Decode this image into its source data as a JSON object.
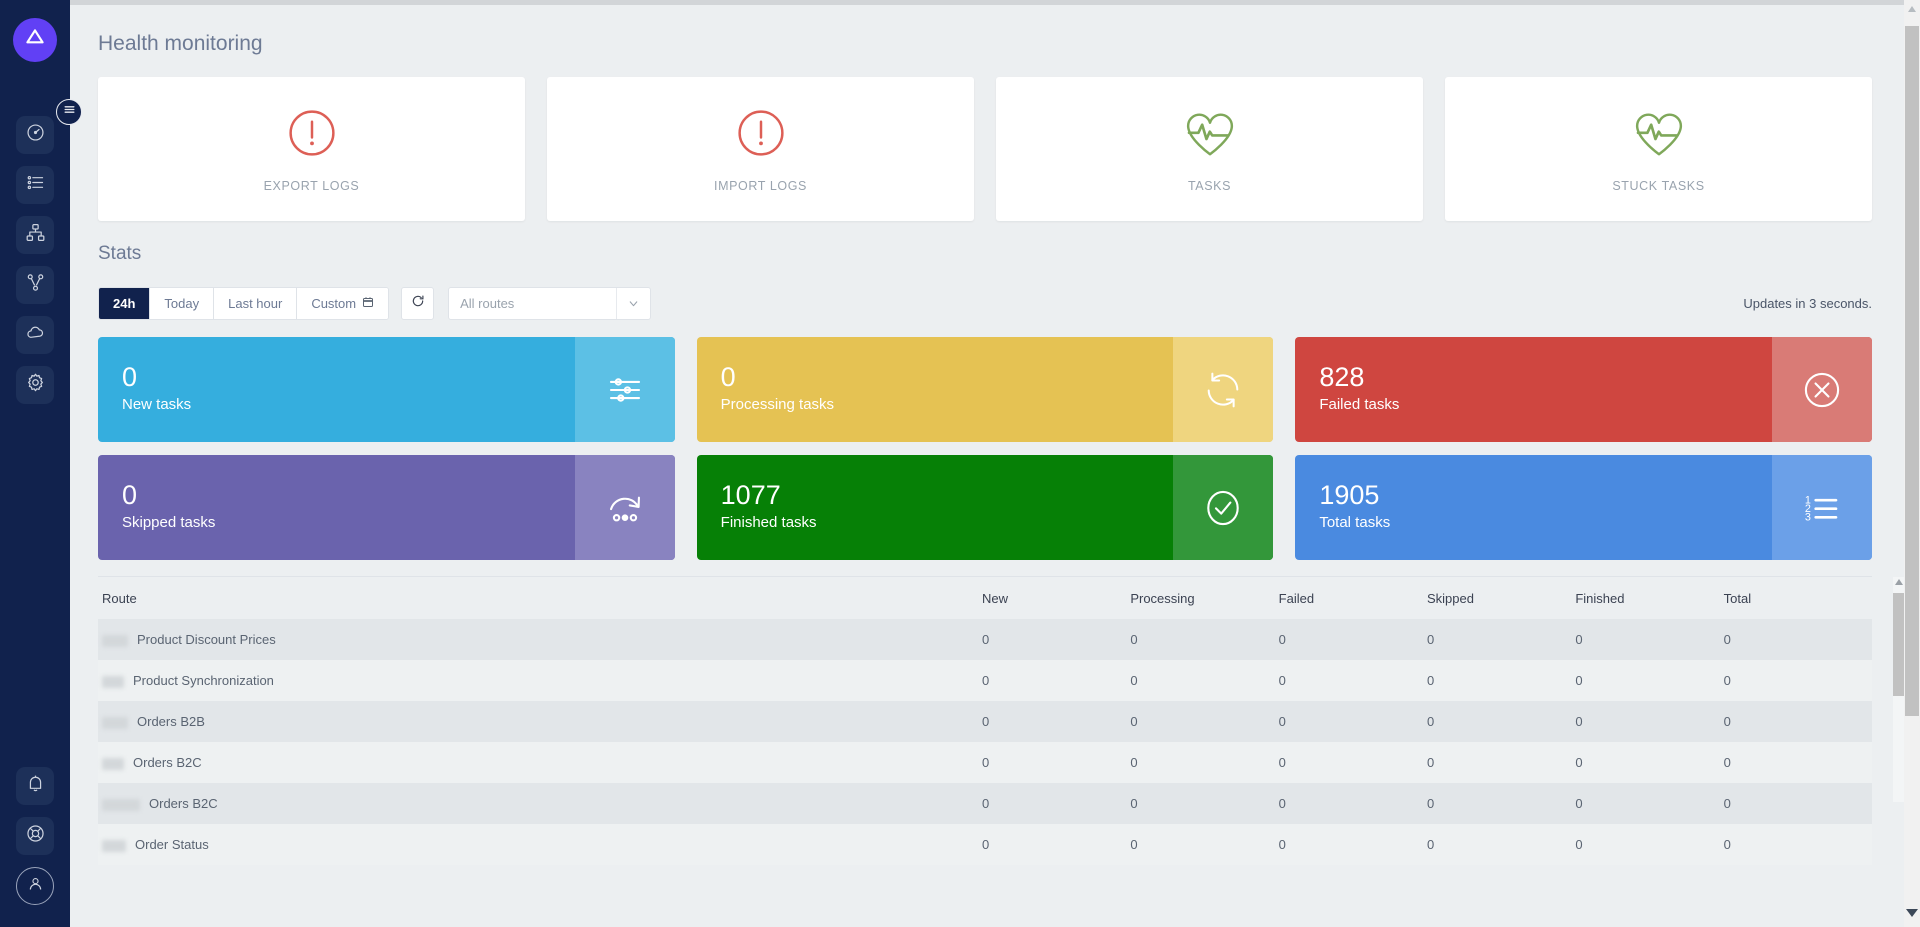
{
  "app": {
    "logo_icon": "bolt-logo-icon",
    "accent": "#6140f5",
    "sidebar_bg": "#11224d"
  },
  "sidebar": {
    "toggle_icon": "hamburger-menu-icon",
    "items": [
      {
        "icon": "dashboard-gauge-icon",
        "name": "sidebar-item-dashboard"
      },
      {
        "icon": "list-icon",
        "name": "sidebar-item-logs"
      },
      {
        "icon": "sitemap-icon",
        "name": "sidebar-item-routes"
      },
      {
        "icon": "branch-icon",
        "name": "sidebar-item-flows"
      },
      {
        "icon": "cloud-icon",
        "name": "sidebar-item-cloud"
      },
      {
        "icon": "gear-icon",
        "name": "sidebar-item-settings"
      }
    ],
    "bottom_items": [
      {
        "icon": "bell-icon",
        "name": "sidebar-item-notifications"
      },
      {
        "icon": "lifebuoy-icon",
        "name": "sidebar-item-help"
      },
      {
        "icon": "user-avatar-icon",
        "name": "sidebar-item-account"
      }
    ]
  },
  "header": {
    "title": "Health monitoring"
  },
  "health_cards": [
    {
      "label": "EXPORT LOGS",
      "icon": "alert-circle-icon",
      "status": "error",
      "color": "#dd5f56"
    },
    {
      "label": "IMPORT LOGS",
      "icon": "alert-circle-icon",
      "status": "error",
      "color": "#dd5f56"
    },
    {
      "label": "TASKS",
      "icon": "heartbeat-icon",
      "status": "ok",
      "color": "#7fa85a"
    },
    {
      "label": "STUCK TASKS",
      "icon": "heartbeat-icon",
      "status": "ok",
      "color": "#7fa85a"
    }
  ],
  "stats": {
    "title": "Stats",
    "filters": [
      {
        "label": "24h",
        "active": true
      },
      {
        "label": "Today",
        "active": false
      },
      {
        "label": "Last hour",
        "active": false
      },
      {
        "label": "Custom",
        "active": false,
        "icon": "calendar-icon"
      }
    ],
    "refresh_icon": "refresh-icon",
    "route_select": {
      "value": "All routes",
      "caret_icon": "chevron-down-icon"
    },
    "updates_text": "Updates in 3 seconds."
  },
  "tiles": [
    {
      "value": "0",
      "label": "New tasks",
      "color": "#35aede",
      "icon_bg": "#5cc0e5",
      "icon": "sliders-icon"
    },
    {
      "value": "0",
      "label": "Processing tasks",
      "color": "#e7c css",
      "icon_bg": "#efd47e",
      "icon": "sync-arrows-icon"
    },
    {
      "value": "828",
      "label": "Failed tasks",
      "color": "#cf4640",
      "icon_bg": "#d96b66",
      "icon": "close-circle-icon"
    },
    {
      "value": "0",
      "label": "Skipped tasks",
      "color": "#6a63ad",
      "icon_bg": "#8983c0",
      "icon": "skip-arrow-icon"
    },
    {
      "value": "1077",
      "label": "Finished tasks",
      "color": "#068006",
      "icon_bg": "#33973a",
      "icon": "check-circle-icon"
    },
    {
      "value": "1905",
      "label": "Total tasks",
      "color": "#4a8ae0",
      "icon_bg": "#6ba0e8",
      "icon": "numbered-list-icon"
    }
  ],
  "tile_colors": {
    "new": "#35aede",
    "new_icon": "#5cc0e5",
    "processing": "#e5c253",
    "processing_icon": "#efd57f",
    "failed": "#cf4640",
    "failed_icon": "#d97b76",
    "skipped": "#6a63ad",
    "skipped_icon": "#8983c0",
    "finished": "#068006",
    "finished_icon": "#33973a",
    "total": "#4a8ae0",
    "total_icon": "#6ba0e8"
  },
  "table": {
    "columns": [
      "Route",
      "New",
      "Processing",
      "Failed",
      "Skipped",
      "Finished",
      "Total"
    ],
    "rows": [
      {
        "route": "Product Discount Prices",
        "redacted_w": 26,
        "new": "0",
        "processing": "0",
        "failed": "0",
        "skipped": "0",
        "finished": "0",
        "total": "0"
      },
      {
        "route": "Product Synchronization",
        "redacted_w": 22,
        "new": "0",
        "processing": "0",
        "failed": "0",
        "skipped": "0",
        "finished": "0",
        "total": "0"
      },
      {
        "route": "Orders B2B",
        "redacted_w": 26,
        "new": "0",
        "processing": "0",
        "failed": "0",
        "skipped": "0",
        "finished": "0",
        "total": "0"
      },
      {
        "route": "Orders B2C",
        "redacted_w": 22,
        "new": "0",
        "processing": "0",
        "failed": "0",
        "skipped": "0",
        "finished": "0",
        "total": "0"
      },
      {
        "route": "Orders B2C",
        "redacted_w": 38,
        "new": "0",
        "processing": "0",
        "failed": "0",
        "skipped": "0",
        "finished": "0",
        "total": "0"
      },
      {
        "route": "Order Status",
        "redacted_w": 24,
        "new": "0",
        "processing": "0",
        "failed": "0",
        "skipped": "0",
        "finished": "0",
        "total": "0"
      }
    ]
  }
}
